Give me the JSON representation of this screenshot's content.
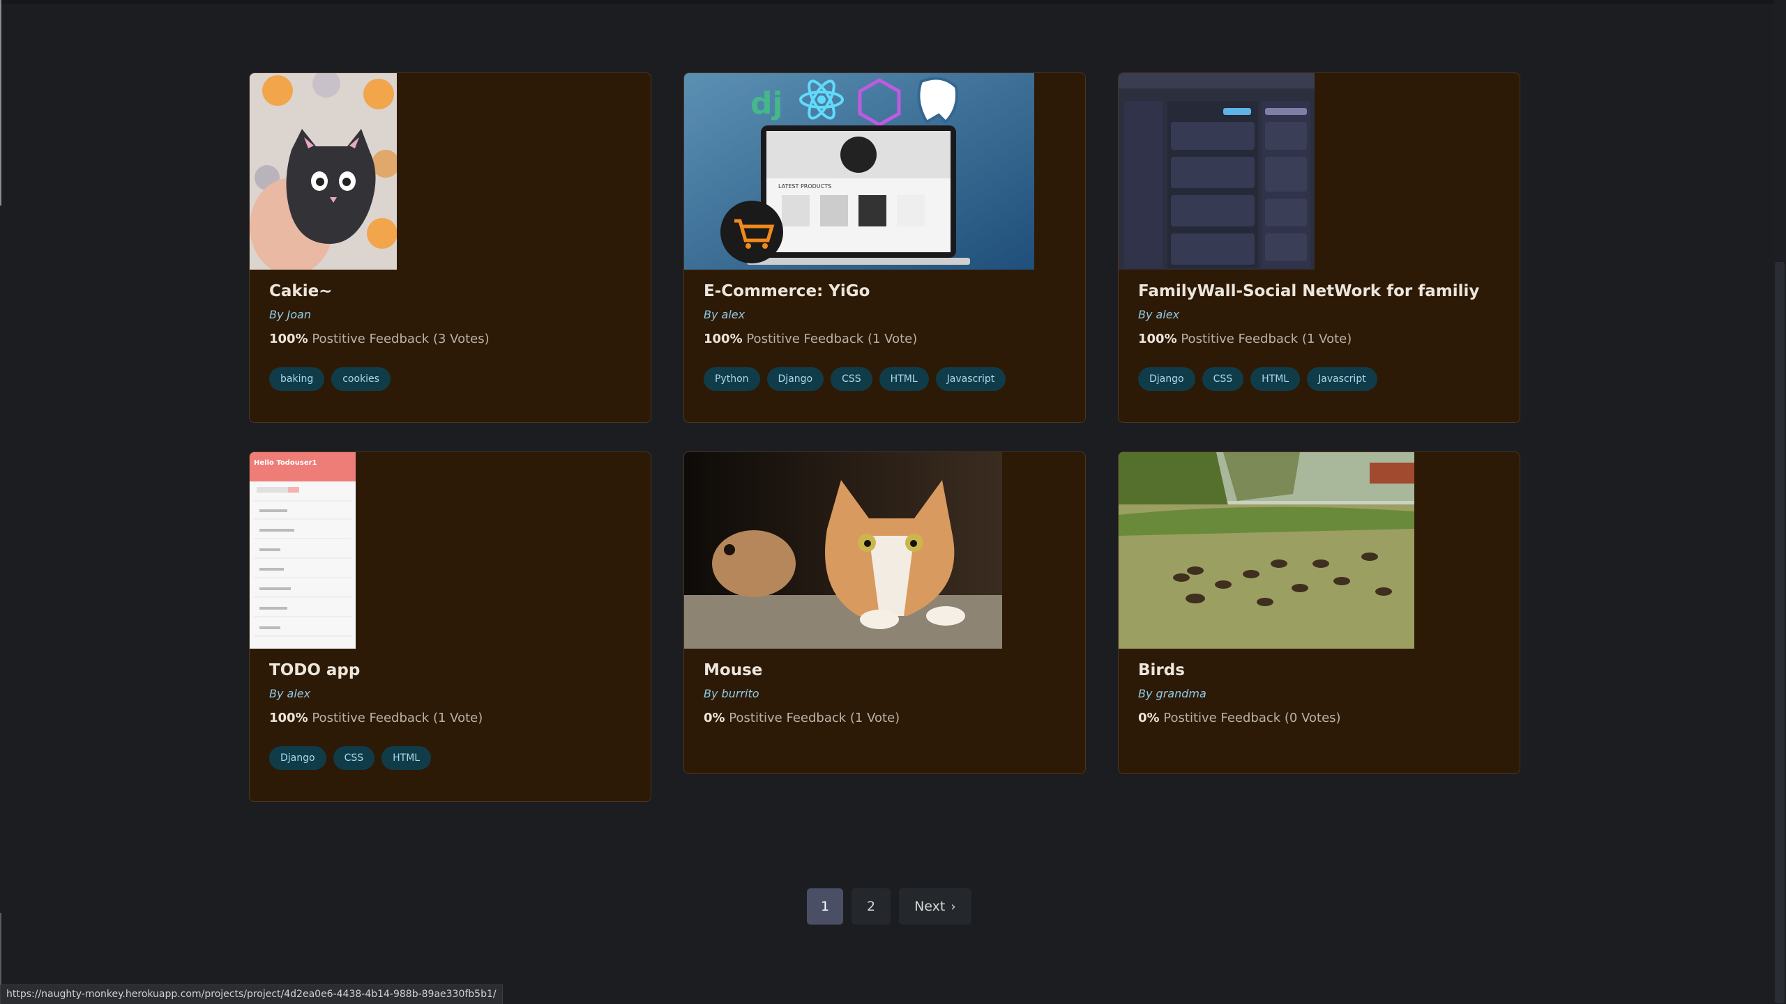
{
  "projects": [
    {
      "title": "Cakie~",
      "by": "By",
      "author": "Joan",
      "pct": "100%",
      "feedback_text": "Postitive Feedback (3 Votes)",
      "tags": [
        "baking",
        "cookies"
      ]
    },
    {
      "title": "E-Commerce: YiGo",
      "by": "By",
      "author": "alex",
      "pct": "100%",
      "feedback_text": "Postitive Feedback (1 Vote)",
      "tags": [
        "Python",
        "Django",
        "CSS",
        "HTML",
        "Javascript"
      ]
    },
    {
      "title": "FamilyWall-Social NetWork for familiy",
      "by": "By",
      "author": "alex",
      "pct": "100%",
      "feedback_text": "Postitive Feedback (1 Vote)",
      "tags": [
        "Django",
        "CSS",
        "HTML",
        "Javascript"
      ]
    },
    {
      "title": "TODO app",
      "by": "By",
      "author": "alex",
      "pct": "100%",
      "feedback_text": "Postitive Feedback (1 Vote)",
      "tags": [
        "Django",
        "CSS",
        "HTML"
      ]
    },
    {
      "title": "Mouse",
      "by": "By",
      "author": "burrito",
      "pct": "0%",
      "feedback_text": "Postitive Feedback (1 Vote)",
      "tags": []
    },
    {
      "title": "Birds",
      "by": "By",
      "author": "grandma",
      "pct": "0%",
      "feedback_text": "Postitive Feedback (0 Votes)",
      "tags": []
    }
  ],
  "thumb_text": {
    "ecommerce_logo_django": "dj",
    "ecommerce_latest": "LATEST PRODUCTS",
    "todo_header": "Hello Todouser1"
  },
  "pagination": {
    "page1": "1",
    "page2": "2",
    "next": "Next",
    "next_icon": "chevron-right-icon"
  },
  "status_url": "https://naughty-monkey.herokuapp.com/projects/project/4d2ea0e6-4438-4b14-988b-89ae330fb5b1/",
  "colors": {
    "card_bg": "#2d1a06",
    "tag_bg": "#103c4a",
    "author": "#8fcbe5",
    "page_bg": "#1b1d21"
  }
}
